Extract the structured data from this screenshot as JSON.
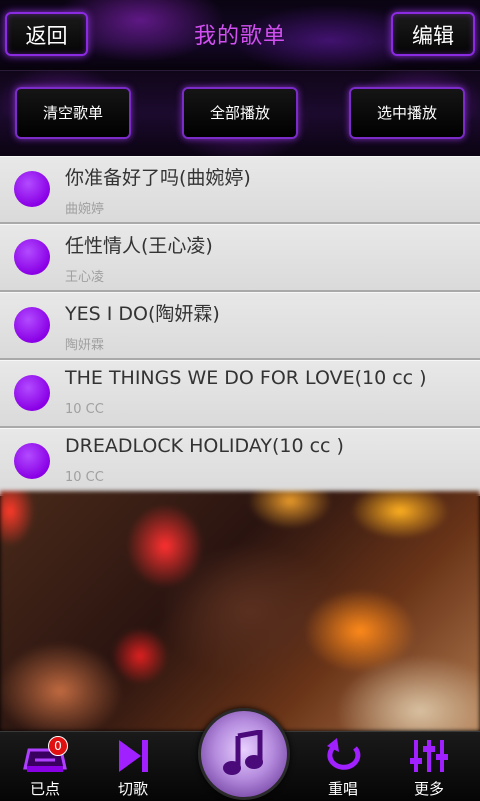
{
  "header": {
    "back_label": "返回",
    "title": "我的歌单",
    "edit_label": "编辑"
  },
  "actions": {
    "clear_label": "清空歌单",
    "play_all_label": "全部播放",
    "play_selected_label": "选中播放"
  },
  "songs": [
    {
      "title": "你准备好了吗(曲婉婷)",
      "artist": "曲婉婷"
    },
    {
      "title": "任性情人(王心凌)",
      "artist": "王心凌"
    },
    {
      "title": "YES I DO(陶妍霖)",
      "artist": "陶妍霖"
    },
    {
      "title": "THE THINGS WE DO FOR LOVE(10 cc )",
      "artist": "10 CC"
    },
    {
      "title": "DREADLOCK HOLIDAY(10 cc )",
      "artist": "10 CC"
    }
  ],
  "nav": {
    "ordered_label": "已点",
    "ordered_badge": "0",
    "skip_label": "切歌",
    "replay_label": "重唱",
    "more_label": "更多",
    "icons": [
      "tray-icon",
      "skip-icon",
      "music-note-icon",
      "replay-icon",
      "equalizer-icon"
    ]
  },
  "colors": {
    "accent": "#8a00e6",
    "title": "#d24ff0",
    "button_border": "#8a2be2"
  }
}
